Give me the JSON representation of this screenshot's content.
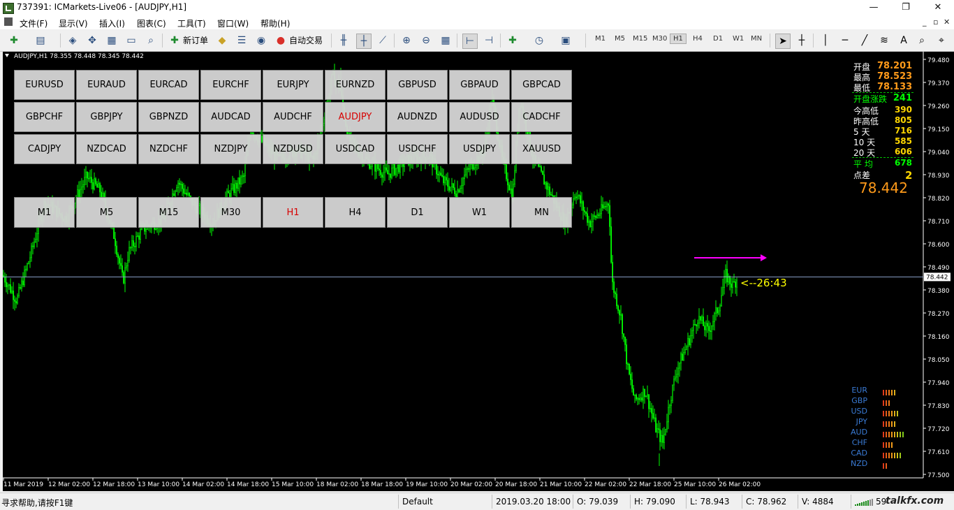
{
  "window": {
    "title": "737391: ICMarkets-Live06 - [AUDJPY,H1]",
    "minimize": "—",
    "restore": "❐",
    "close": "✕"
  },
  "menu": [
    "文件(F)",
    "显示(V)",
    "插入(I)",
    "图表(C)",
    "工具(T)",
    "窗口(W)",
    "帮助(H)"
  ],
  "mdi": {
    "min": "_",
    "restore": "▫",
    "close": "✕"
  },
  "toolbar": {
    "new_order": "新订单",
    "auto_trade": "自动交易",
    "timeframes": [
      "M1",
      "M5",
      "M15",
      "M30",
      "H1",
      "H4",
      "D1",
      "W1",
      "MN"
    ],
    "active_timeframe": "H1"
  },
  "chart": {
    "caption": "AUDJPY,H1  78.355 78.448 78.345 78.442",
    "symbol_buttons": [
      [
        "EURUSD",
        "EURAUD",
        "EURCAD",
        "EURCHF",
        "EURJPY",
        "EURNZD",
        "GBPUSD",
        "GBPAUD",
        "GBPCAD"
      ],
      [
        "GBPCHF",
        "GBPJPY",
        "GBPNZD",
        "AUDCAD",
        "AUDCHF",
        "AUDJPY",
        "AUDNZD",
        "AUDUSD",
        "CADCHF"
      ],
      [
        "CADJPY",
        "NZDCAD",
        "NZDCHF",
        "NZDJPY",
        "NZDUSD",
        "USDCAD",
        "USDCHF",
        "USDJPY",
        "XAUUSD"
      ]
    ],
    "active_symbol": "AUDJPY",
    "tf_buttons": [
      "M1",
      "M5",
      "M15",
      "M30",
      "H1",
      "H4",
      "D1",
      "W1",
      "MN"
    ],
    "price_axis": [
      "79.480",
      "79.370",
      "79.260",
      "79.150",
      "79.040",
      "78.930",
      "78.820",
      "78.710",
      "78.600",
      "78.490",
      "78.380",
      "78.270",
      "78.160",
      "78.050",
      "77.940",
      "77.830",
      "77.720",
      "77.610",
      "77.500"
    ],
    "current_price": "78.442",
    "time_axis": [
      "11 Mar 2019",
      "12 Mar 02:00",
      "12 Mar 18:00",
      "13 Mar 10:00",
      "14 Mar 02:00",
      "14 Mar 18:00",
      "15 Mar 10:00",
      "18 Mar 02:00",
      "18 Mar 18:00",
      "19 Mar 10:00",
      "20 Mar 02:00",
      "20 Mar 18:00",
      "21 Mar 10:00",
      "22 Mar 02:00",
      "22 Mar 18:00",
      "25 Mar 10:00",
      "26 Mar 02:00"
    ],
    "countdown": "<--26:43",
    "info_panel": [
      {
        "label": "开盘",
        "value": "78.201",
        "color": "#ff9a1a"
      },
      {
        "label": "最高",
        "value": "78.523",
        "color": "#ff9a1a"
      },
      {
        "label": "最低",
        "value": "78.133",
        "color": "#ff9a1a"
      },
      {
        "label": "开盘涨跌",
        "value": "241",
        "color": "#00ff00"
      },
      {
        "label": "今高低",
        "value": "390",
        "color": "#ffd700"
      },
      {
        "label": "昨高低",
        "value": "805",
        "color": "#ffd700"
      },
      {
        "label": "5  天",
        "value": "716",
        "color": "#ffd700"
      },
      {
        "label": "10 天",
        "value": "585",
        "color": "#ffd700"
      },
      {
        "label": "20 天",
        "value": "606",
        "color": "#ffd700"
      },
      {
        "label": "平  均",
        "value": "678",
        "color": "#00ff00"
      },
      {
        "label": "点差",
        "value": "2",
        "color": "#ffd700"
      }
    ],
    "big_price": "78.442",
    "currency_strength": [
      {
        "ccy": "EUR",
        "bars": 5
      },
      {
        "ccy": "GBP",
        "bars": 3
      },
      {
        "ccy": "USD",
        "bars": 6
      },
      {
        "ccy": "JPY",
        "bars": 5
      },
      {
        "ccy": "AUD",
        "bars": 8
      },
      {
        "ccy": "CHF",
        "bars": 4
      },
      {
        "ccy": "CAD",
        "bars": 7
      },
      {
        "ccy": "NZD",
        "bars": 2
      }
    ]
  },
  "status": {
    "help": "寻求帮助,请按F1键",
    "profile": "Default",
    "datetime": "2019.03.20 18:00",
    "open": "O: 79.039",
    "high": "H: 79.090",
    "low": "L: 78.943",
    "close": "C: 78.962",
    "volume": "V: 4884",
    "traffic": "59",
    "watermark": "talkfx.com"
  }
}
